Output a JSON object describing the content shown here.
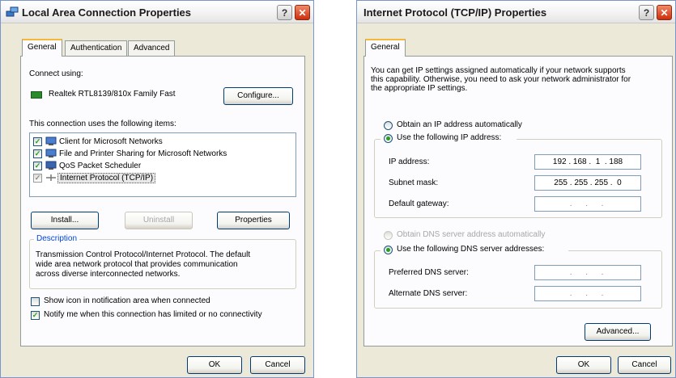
{
  "left_window": {
    "title": "Local Area Connection Properties",
    "help_glyph": "?",
    "close_glyph": "✕",
    "tabs": [
      "General",
      "Authentication",
      "Advanced"
    ],
    "connect_using_label": "Connect using:",
    "adapter_name": "Realtek RTL8139/810x Family Fast",
    "configure_button": "Configure...",
    "items_label": "This connection uses the following items:",
    "items": [
      {
        "label": "Client for Microsoft Networks",
        "checked": true
      },
      {
        "label": "File and Printer Sharing for Microsoft Networks",
        "checked": true
      },
      {
        "label": "QoS Packet Scheduler",
        "checked": true
      },
      {
        "label": "Internet Protocol (TCP/IP)",
        "checked": true
      }
    ],
    "install_button": "Install...",
    "uninstall_button": "Uninstall",
    "properties_button": "Properties",
    "description_legend": "Description",
    "description_text": [
      "Transmission Control Protocol/Internet Protocol. The default",
      "wide area network protocol that provides communication",
      "across diverse interconnected networks."
    ],
    "show_icon_label": "Show icon in notification area when connected",
    "notify_label": "Notify me when this connection has limited or no connectivity",
    "ok_button": "OK",
    "cancel_button": "Cancel"
  },
  "right_window": {
    "title": "Internet Protocol (TCP/IP) Properties",
    "help_glyph": "?",
    "close_glyph": "✕",
    "tab": "General",
    "intro": [
      "You can get IP settings assigned automatically if your network supports",
      "this capability. Otherwise, you need to ask your network administrator for",
      "the appropriate IP settings."
    ],
    "radio_auto_ip": "Obtain an IP address automatically",
    "radio_use_ip": "Use the following IP address:",
    "ip_address_label": "IP address:",
    "ip_address_value": "192 . 168 .  1  . 188",
    "subnet_label": "Subnet mask:",
    "subnet_value": "255 . 255 . 255 .  0",
    "gateway_label": "Default gateway:",
    "gateway_value": " .      .      .  ",
    "radio_auto_dns": "Obtain DNS server address automatically",
    "radio_use_dns": "Use the following DNS server addresses:",
    "preferred_dns_label": "Preferred DNS server:",
    "preferred_dns_value": " .      .      .  ",
    "alternate_dns_label": "Alternate DNS server:",
    "alternate_dns_value": " .      .      .  ",
    "advanced_button": "Advanced...",
    "ok_button": "OK",
    "cancel_button": "Cancel"
  },
  "colors": {
    "window_bg": "#ece9d8",
    "panel_bg": "#fcfcfe",
    "legend_blue": "#0046d5",
    "check_green": "#21a121",
    "close_red": "#cd2e0a"
  }
}
